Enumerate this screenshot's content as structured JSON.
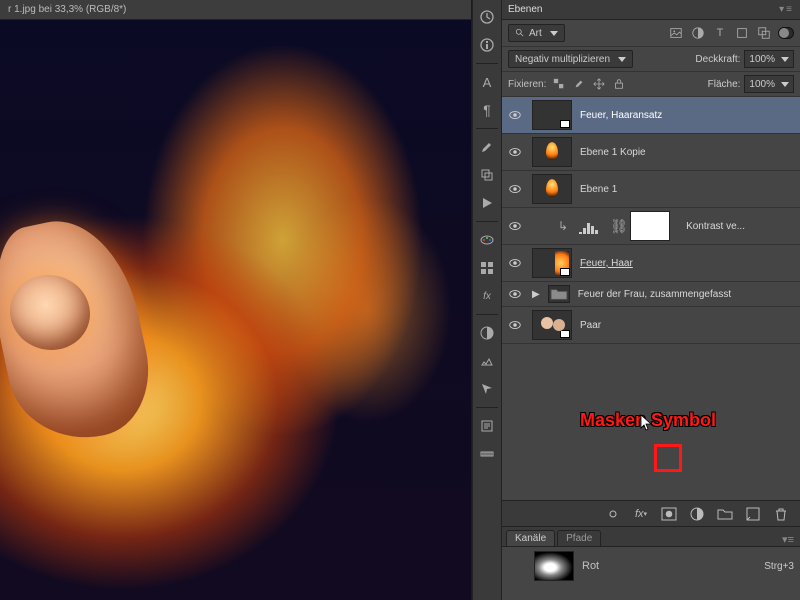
{
  "document": {
    "title": "r 1.jpg bei 33,3% (RGB/8*)"
  },
  "layersPanel": {
    "title": "Ebenen",
    "filterLabel": "Art",
    "blendMode": "Negativ multiplizieren",
    "opacityLabel": "Deckkraft:",
    "opacityValue": "100%",
    "lockLabel": "Fixieren:",
    "fillLabel": "Fläche:",
    "fillValue": "100%"
  },
  "layers": [
    {
      "name": "Feuer, Haaransatz"
    },
    {
      "name": "Ebene 1 Kopie"
    },
    {
      "name": "Ebene 1"
    },
    {
      "name": "Kontrast ve..."
    },
    {
      "name": "Feuer, Haar"
    },
    {
      "name": "Feuer der Frau, zusammengefasst"
    },
    {
      "name": "Paar"
    }
  ],
  "channels": {
    "tabActive": "Kanäle",
    "tabInactive": "Pfade",
    "first": {
      "name": "Rot",
      "shortcut": "Strg+3"
    }
  },
  "annotation": {
    "text": "Masken Symbol"
  }
}
